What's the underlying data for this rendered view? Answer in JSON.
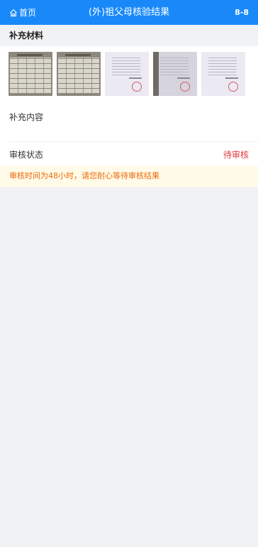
{
  "header": {
    "home_label": "首页",
    "title": "(外)祖父母核验结果",
    "code": "8-8"
  },
  "section": {
    "title": "补充材料"
  },
  "attachments": [
    {
      "kind": "form"
    },
    {
      "kind": "form"
    },
    {
      "kind": "letter"
    },
    {
      "kind": "letter-dark"
    },
    {
      "kind": "letter"
    }
  ],
  "supplement": {
    "label": "补充内容",
    "value": ""
  },
  "review": {
    "label": "审核状态",
    "status": "待审核",
    "status_color": "#e0383e"
  },
  "notice": {
    "text": "审核时间为48小时，请您耐心等待审核结果",
    "color": "#ed6a0c",
    "background": "#fffbe8"
  },
  "colors": {
    "brand": "#1989fa"
  }
}
